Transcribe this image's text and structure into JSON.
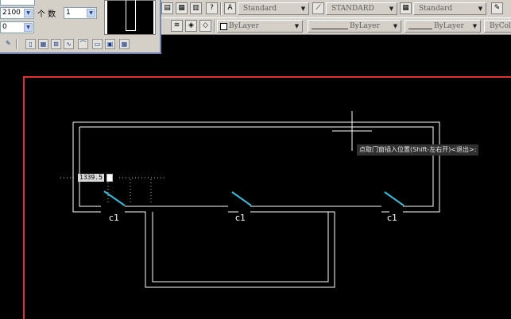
{
  "toolbar": {
    "text_style": "Standard",
    "dim_style": "STANDARD",
    "table_style": "Standard",
    "layer_color": "ByLayer",
    "linetype": "ByLayer",
    "lineweight": "ByLayer",
    "plot_color": "ByColor"
  },
  "panel": {
    "width_value": "2100",
    "count_label": "个 数",
    "count_value": "1",
    "elevation_value": "0"
  },
  "drawing": {
    "window_tags": [
      "c1",
      "c1",
      "c1"
    ],
    "dimension_value": "1339.5",
    "command_prompt": "点取门窗插入位置(Shift-左右开)<退出>:",
    "border_color": "#e03030",
    "wall_color": "#ffffff",
    "window_color": "#30c0e0"
  }
}
